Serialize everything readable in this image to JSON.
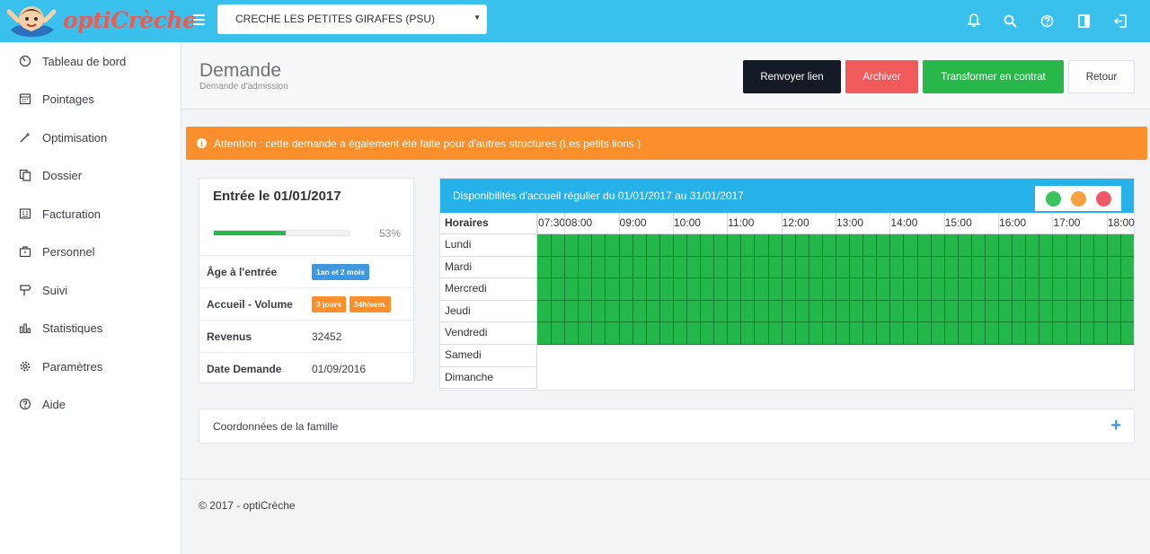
{
  "brand": {
    "name": "optiCrèche"
  },
  "header": {
    "structure_select": "CRECHE LES PETITES GIRAFES (PSU)",
    "icons": [
      "bell-icon",
      "search-icon",
      "help-icon",
      "panel-icon",
      "logout-icon"
    ]
  },
  "sidebar": {
    "items": [
      {
        "label": "Tableau de bord",
        "icon": "dashboard-icon"
      },
      {
        "label": "Pointages",
        "icon": "calendar-icon"
      },
      {
        "label": "Optimisation",
        "icon": "magic-wand-icon"
      },
      {
        "label": "Dossier",
        "icon": "copy-icon"
      },
      {
        "label": "Facturation",
        "icon": "invoice-icon"
      },
      {
        "label": "Personnel",
        "icon": "briefcase-icon"
      },
      {
        "label": "Suivi",
        "icon": "signpost-icon"
      },
      {
        "label": "Statistiques",
        "icon": "bar-chart-icon"
      },
      {
        "label": "Paramètres",
        "icon": "gear-icon"
      },
      {
        "label": "Aide",
        "icon": "help-circle-icon"
      }
    ]
  },
  "page": {
    "title": "Demande",
    "subtitle": "Demande d'admission",
    "buttons": {
      "resend": "Renvoyer lien",
      "archive": "Archiver",
      "convert": "Transformer en contrat",
      "back": "Retour"
    }
  },
  "alert": {
    "text": "Attention : cette demande a également été faite pour d'autres structures (Les petits lions )",
    "icon_glyph": "i"
  },
  "entry": {
    "title": "Entrée le 01/01/2017",
    "progress_value": 53,
    "progress_label": "53%",
    "rows": [
      {
        "label": "Âge à l'entrée",
        "badges": [
          "1an et 2 mois"
        ]
      },
      {
        "label": "Accueil - Volume",
        "badges": [
          "3 jours",
          "34h/sem."
        ]
      },
      {
        "label": "Revenus",
        "value": "32452"
      },
      {
        "label": "Date Demande",
        "value": "01/09/2016"
      }
    ]
  },
  "availability": {
    "title": "Disponibilités d'accueil régulier du 01/01/2017 au 31/01/2017",
    "legend_colors": [
      "#3ac45d",
      "#f9a040",
      "#ef5a66"
    ],
    "slot_color": "#24b84a",
    "hours_header": "Horaires",
    "hours": [
      "07:30",
      "08:00",
      "09:00",
      "10:00",
      "11:00",
      "12:00",
      "13:00",
      "14:00",
      "15:00",
      "16:00",
      "17:00",
      "18:00"
    ],
    "days": [
      {
        "label": "Lundi",
        "available": true
      },
      {
        "label": "Mardi",
        "available": true
      },
      {
        "label": "Mercredi",
        "available": true
      },
      {
        "label": "Jeudi",
        "available": true
      },
      {
        "label": "Vendredi",
        "available": true
      },
      {
        "label": "Samedi",
        "available": false
      },
      {
        "label": "Dimanche",
        "available": false
      }
    ]
  },
  "family": {
    "label": "Coordonnées de la famille",
    "expand_glyph": "+"
  },
  "footer": {
    "text": "© 2017 - optiCrèche"
  }
}
